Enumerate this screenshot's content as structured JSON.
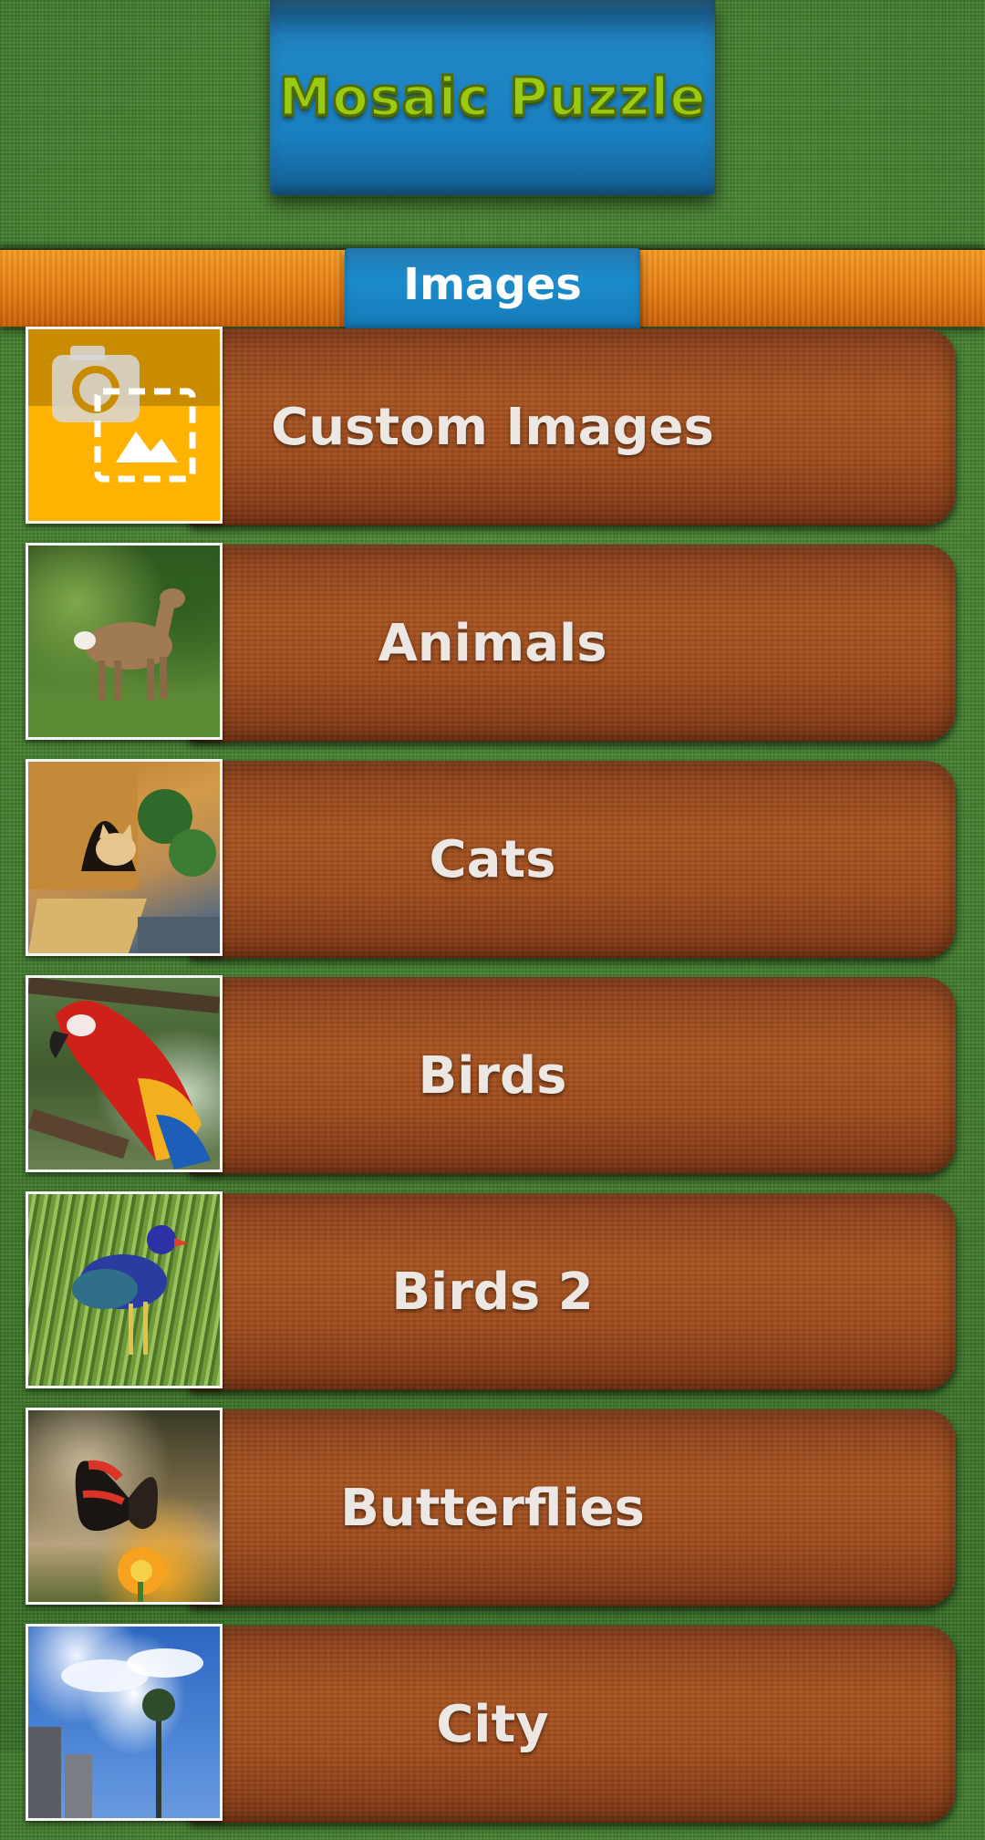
{
  "header": {
    "logo_text": "Mosaic Puzzle"
  },
  "section": {
    "title": "Images"
  },
  "categories": [
    {
      "label": "Custom Images",
      "icon": "camera-gallery-icon"
    },
    {
      "label": "Animals",
      "icon": "deer-thumbnail"
    },
    {
      "label": "Cats",
      "icon": "cat-thumbnail"
    },
    {
      "label": "Birds",
      "icon": "parrot-thumbnail"
    },
    {
      "label": "Birds 2",
      "icon": "blue-bird-thumbnail"
    },
    {
      "label": "Butterflies",
      "icon": "butterfly-thumbnail"
    },
    {
      "label": "City",
      "icon": "city-thumbnail"
    }
  ],
  "colors": {
    "background_green": "#3f7a2a",
    "banner_orange": "#e57c12",
    "header_blue": "#1f86c4",
    "logo_green": "#9acb12",
    "wood_brown": "#a04c1c",
    "custom_tile_yellow": "#ffb300"
  }
}
